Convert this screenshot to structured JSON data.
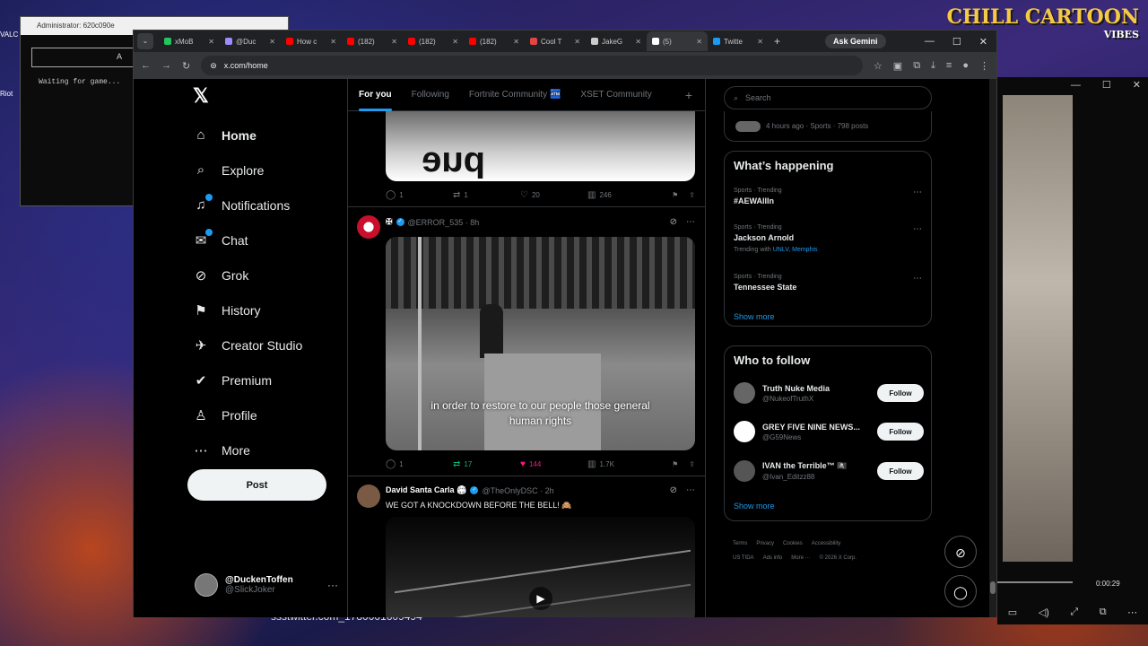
{
  "desktop": {
    "admin_title": "Administrator: 620c090e",
    "apt_text": "A P T I",
    "waiting": "Waiting for game...",
    "icon_a": "VALC",
    "icon_b": "Riot",
    "brand": "CHILL CARTOON",
    "brand_sub": "VIBES",
    "video_time": "0:00:29",
    "bottom_url": "ssstwitter.com_1780001609494"
  },
  "browser": {
    "tabs": [
      {
        "label": "xMoB",
        "color": "#22c55e"
      },
      {
        "label": "@Duc",
        "color": "#9b8cff"
      },
      {
        "label": "How c",
        "color": "#ff0000"
      },
      {
        "label": "(182)",
        "color": "#ff0000"
      },
      {
        "label": "(182)",
        "color": "#ff0000"
      },
      {
        "label": "(182)",
        "color": "#ff0000"
      },
      {
        "label": "Cool T",
        "color": "#e54444"
      },
      {
        "label": "JakeG",
        "color": "#cccccc"
      },
      {
        "label": "(5)",
        "color": "#ffffff",
        "active": true
      },
      {
        "label": "Twitte",
        "color": "#1d9bf0"
      }
    ],
    "ask_gemini": "Ask Gemini",
    "url": "x.com/home"
  },
  "nav": {
    "logo": "𝕏",
    "items": [
      {
        "label": "Home",
        "icon": "⌂"
      },
      {
        "label": "Explore",
        "icon": "⌕"
      },
      {
        "label": "Notifications",
        "icon": "♫"
      },
      {
        "label": "Chat",
        "icon": "✉"
      },
      {
        "label": "Grok",
        "icon": "⊘"
      },
      {
        "label": "History",
        "icon": "⚑"
      },
      {
        "label": "Creator Studio",
        "icon": "✈"
      },
      {
        "label": "Premium",
        "icon": "✔"
      },
      {
        "label": "Profile",
        "icon": "♙"
      },
      {
        "label": "More",
        "icon": "⋯"
      }
    ],
    "post": "Post",
    "me_name": "@DuckenToffen",
    "me_handle": "@SlickJoker",
    "me_more": "···"
  },
  "feed": {
    "tabs": [
      "For you",
      "Following",
      "Fortnite Community 🏧",
      "XSET Community"
    ],
    "plus": "+",
    "post1": {
      "img_text": "ənd",
      "actions": {
        "reply": "1",
        "retweet": "1",
        "like": "20",
        "views": "246"
      }
    },
    "post2": {
      "name": "✠",
      "handle": "@ERROR_535 · 8h",
      "caption_l1": "in order to restore to our people those general",
      "caption_l2": "human rights",
      "actions": {
        "reply": "1",
        "retweet": "17",
        "like": "144",
        "views": "1.7K"
      }
    },
    "post3": {
      "name": "David Santa Carla 🏟",
      "handle": "@TheOnlyDSC · 2h",
      "text": "WE GOT A KNOCKDOWN BEFORE THE BELL! 🙈"
    }
  },
  "right": {
    "search_placeholder": "Search",
    "top_meta": "4 hours ago · Sports · 798 posts",
    "happening": "What’s happening",
    "trends": [
      {
        "meta": "Sports · Trending",
        "title": "#AEWAllIn",
        "with": ""
      },
      {
        "meta": "Sports · Trending",
        "title": "Jackson Arnold",
        "with": "Trending with",
        "tags": "UNLV, Memphis"
      },
      {
        "meta": "Sports · Trending",
        "title": "Tennessee State",
        "with": ""
      }
    ],
    "show_more": "Show more",
    "who": "Who to follow",
    "follows": [
      {
        "name": "Truth Nuke Media",
        "handle": "@NukeofTruthX",
        "color": "#666"
      },
      {
        "name": "GREY FIVE NINE NEWS...",
        "handle": "@G59News",
        "color": "#ffffff"
      },
      {
        "name": "IVAN the Terrible™ 🏴‍☠️",
        "handle": "@Ivan_Editzz88",
        "color": "#555"
      }
    ],
    "follow_label": "Follow",
    "footer": [
      "Terms",
      "Privacy",
      "Cookies",
      "Accessibility",
      "US TIDA",
      "Ads info",
      "More ···",
      "© 2026 X Corp."
    ]
  }
}
